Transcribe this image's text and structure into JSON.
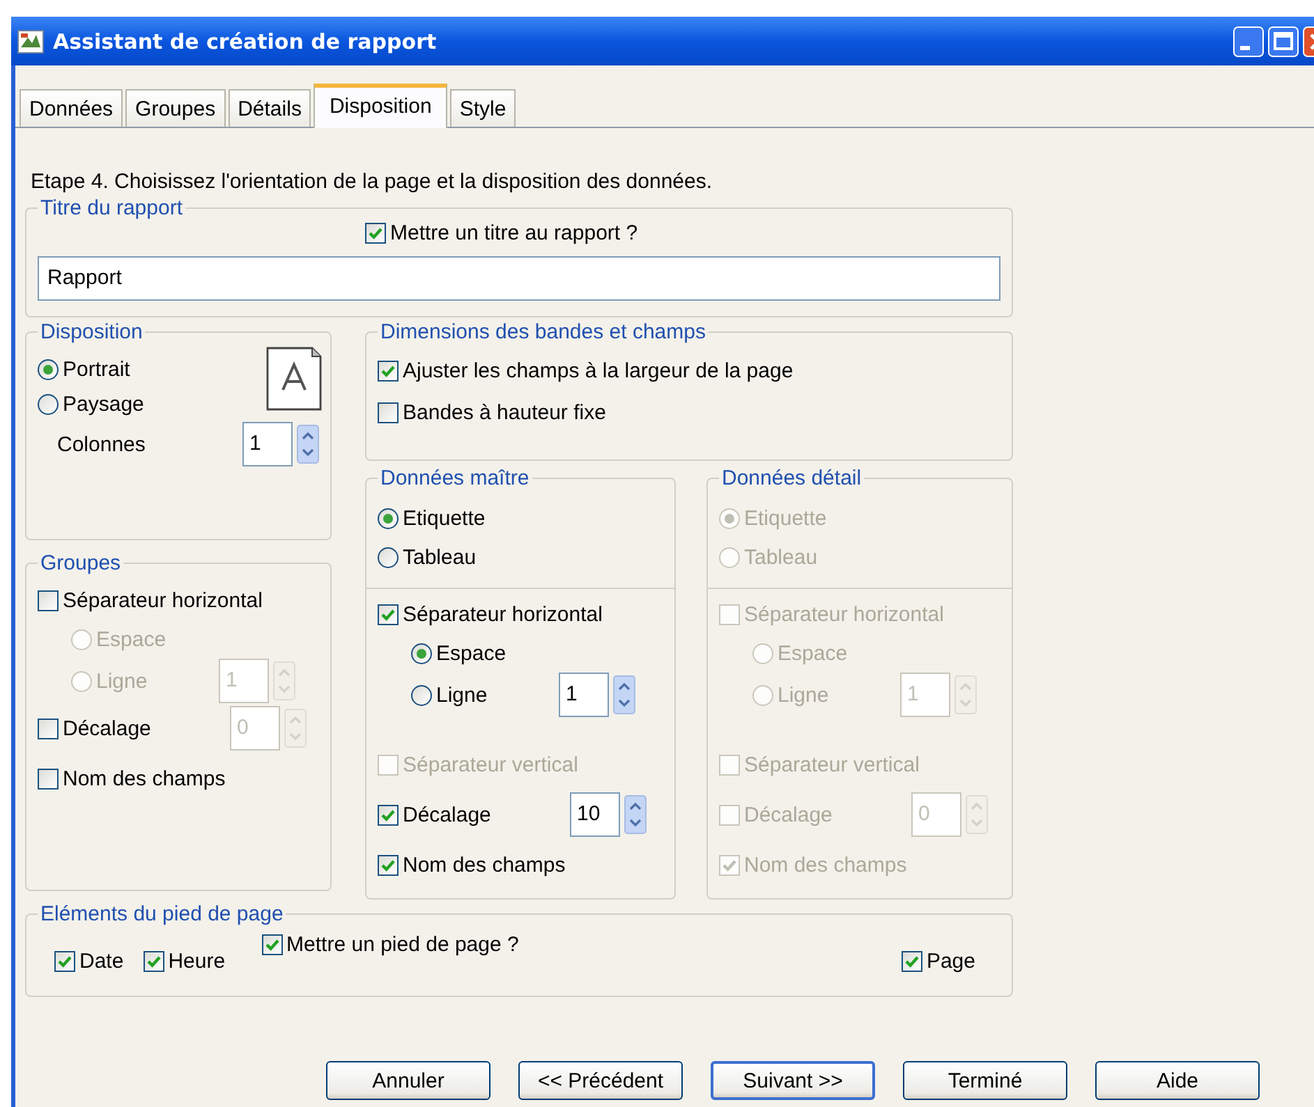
{
  "window": {
    "title": "Assistant de création de rapport"
  },
  "tabs": [
    {
      "label": "Données",
      "selected": false
    },
    {
      "label": "Groupes",
      "selected": false
    },
    {
      "label": "Détails",
      "selected": false
    },
    {
      "label": "Disposition",
      "selected": true
    },
    {
      "label": "Style",
      "selected": false
    }
  ],
  "instruction": "Etape 4. Choisissez l'orientation de la page et la disposition des données.",
  "report_title": {
    "legend": "Titre du rapport",
    "checkbox": {
      "label": "Mettre un titre au rapport ?",
      "checked": true
    },
    "value": "Rapport"
  },
  "layout": {
    "legend": "Disposition",
    "orientation": [
      {
        "label": "Portrait",
        "selected": true
      },
      {
        "label": "Paysage",
        "selected": false
      }
    ],
    "columns": {
      "label": "Colonnes",
      "value": "1"
    }
  },
  "dimensions": {
    "legend": "Dimensions des bandes et champs",
    "options": [
      {
        "label": "Ajuster les champs à la largeur de la page",
        "checked": true
      },
      {
        "label": "Bandes à hauteur fixe",
        "checked": false
      }
    ]
  },
  "groups": {
    "legend": "Groupes",
    "horizontal": {
      "label": "Séparateur horizontal",
      "checked": false,
      "disabled": false,
      "options": [
        {
          "label": "Espace",
          "selected": false,
          "disabled": true
        },
        {
          "label": "Ligne",
          "selected": false,
          "disabled": true
        }
      ],
      "line_count": {
        "value": "1",
        "disabled": true
      }
    },
    "items": [
      {
        "label": "Décalage",
        "checked": false,
        "disabled": false,
        "spin": {
          "value": "0",
          "disabled": true
        }
      },
      {
        "label": "Nom des champs",
        "checked": false,
        "disabled": false
      }
    ]
  },
  "master": {
    "legend": "Données maître",
    "style": [
      {
        "label": "Etiquette",
        "selected": true,
        "disabled": false
      },
      {
        "label": "Tableau",
        "selected": false,
        "disabled": false
      }
    ],
    "horizontal": {
      "label": "Séparateur horizontal",
      "checked": true,
      "disabled": false,
      "options": [
        {
          "label": "Espace",
          "selected": true,
          "disabled": false
        },
        {
          "label": "Ligne",
          "selected": false,
          "disabled": false
        }
      ],
      "line_count": {
        "value": "1",
        "disabled": false
      }
    },
    "items": [
      {
        "label": "Séparateur vertical",
        "checked": false,
        "disabled": true
      },
      {
        "label": "Décalage",
        "checked": true,
        "disabled": false,
        "spin": {
          "value": "10",
          "disabled": false
        }
      },
      {
        "label": "Nom des champs",
        "checked": true,
        "disabled": false
      }
    ]
  },
  "detail": {
    "legend": "Données détail",
    "style": [
      {
        "label": "Etiquette",
        "selected": true,
        "disabled": true
      },
      {
        "label": "Tableau",
        "selected": false,
        "disabled": true
      }
    ],
    "horizontal": {
      "label": "Séparateur horizontal",
      "checked": false,
      "disabled": true,
      "options": [
        {
          "label": "Espace",
          "selected": false,
          "disabled": true
        },
        {
          "label": "Ligne",
          "selected": false,
          "disabled": true
        }
      ],
      "line_count": {
        "value": "1",
        "disabled": true
      }
    },
    "items": [
      {
        "label": "Séparateur vertical",
        "checked": false,
        "disabled": true
      },
      {
        "label": "Décalage",
        "checked": false,
        "disabled": true,
        "spin": {
          "value": "0",
          "disabled": true
        }
      },
      {
        "label": "Nom des champs",
        "checked": true,
        "disabled": true
      }
    ]
  },
  "footer": {
    "legend": "Eléments du pied de page",
    "date_time": [
      {
        "label": "Date",
        "checked": true
      },
      {
        "label": "Heure",
        "checked": true
      }
    ],
    "show": {
      "label": "Mettre un pied de page ?",
      "checked": true
    },
    "page": {
      "label": "Page",
      "checked": true
    }
  },
  "buttons": [
    {
      "label": "Annuler",
      "default": false
    },
    {
      "label": "<< Précédent",
      "default": false
    },
    {
      "label": "Suivant >>",
      "default": true
    },
    {
      "label": "Terminé",
      "default": false
    },
    {
      "label": "Aide",
      "default": false
    }
  ]
}
